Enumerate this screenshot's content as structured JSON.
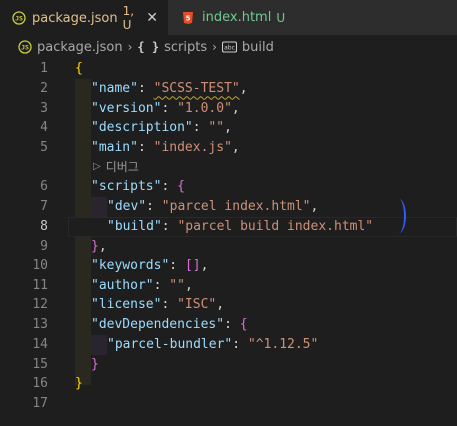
{
  "tabs": [
    {
      "label": "package.json",
      "status": "1, U",
      "close": "✕",
      "icon_text": "{}"
    },
    {
      "label": "index.html",
      "status": "U",
      "icon_text": "5"
    }
  ],
  "breadcrumb": {
    "file": "package.json",
    "braces": "{ }",
    "section": "scripts",
    "item": "build"
  },
  "codelens": {
    "label": "디버그"
  },
  "lines": [
    {
      "n": "1"
    },
    {
      "n": "2"
    },
    {
      "n": "3"
    },
    {
      "n": "4"
    },
    {
      "n": "5"
    },
    {
      "n": "6"
    },
    {
      "n": "7"
    },
    {
      "n": "8"
    },
    {
      "n": "9"
    },
    {
      "n": "10"
    },
    {
      "n": "11"
    },
    {
      "n": "12"
    },
    {
      "n": "13"
    },
    {
      "n": "14"
    },
    {
      "n": "15"
    },
    {
      "n": "16"
    },
    {
      "n": "17"
    }
  ],
  "code": {
    "open_brace": "{",
    "name_key": "\"name\"",
    "name_val": "\"SCSS-TEST\"",
    "version_key": "\"version\"",
    "version_val": "\"1.0.0\"",
    "description_key": "\"description\"",
    "description_val": "\"\"",
    "main_key": "\"main\"",
    "main_val": "\"index.js\"",
    "scripts_key": "\"scripts\"",
    "scripts_open": "{",
    "dev_key": "\"dev\"",
    "dev_val": "\"parcel index.html\"",
    "build_key": "\"build\"",
    "build_val": "\"parcel build index.html\"",
    "scripts_close": "}",
    "keywords_key": "\"keywords\"",
    "keywords_val": "[]",
    "author_key": "\"author\"",
    "author_val": "\"\"",
    "license_key": "\"license\"",
    "license_val": "\"ISC\"",
    "devdeps_key": "\"devDependencies\"",
    "devdeps_open": "{",
    "bundler_key": "\"parcel-bundler\"",
    "bundler_val": "\"^1.12.5\"",
    "devdeps_close": "}",
    "close_brace": "}"
  },
  "colors": {
    "modified": "#e2c08d",
    "untracked": "#73c991",
    "json_key": "#9cdcfe",
    "json_string": "#ce9178",
    "bracket_gold": "#ffd700",
    "bracket_purple": "#da70d6"
  }
}
